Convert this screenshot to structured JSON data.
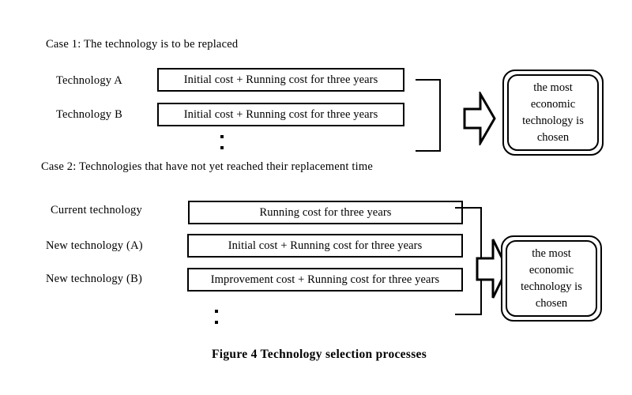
{
  "figure": {
    "caption": "Figure 4   Technology selection processes"
  },
  "case1": {
    "heading": "Case 1: The technology is to be replaced",
    "rows": [
      {
        "label": "Technology A",
        "box": "Initial cost + Running cost for three years"
      },
      {
        "label": "Technology B",
        "box": "Initial cost + Running cost for three years"
      }
    ],
    "ellipsis": "vertical-ellipsis",
    "arrow": "right-block-arrow",
    "result": {
      "lines": [
        "the most",
        "economic",
        "technology is",
        "chosen"
      ]
    }
  },
  "case2": {
    "heading": "Case 2:  Technologies that have not yet reached their replacement time",
    "rows": [
      {
        "label": "Current technology",
        "box": "Running cost for three years"
      },
      {
        "label": "New technology (A)",
        "box": "Initial cost + Running cost for three years"
      },
      {
        "label": "New technology (B)",
        "box": "Improvement cost + Running cost for three years"
      }
    ],
    "ellipsis": "vertical-ellipsis",
    "arrow": "right-block-arrow",
    "result": {
      "lines": [
        "the most",
        "economic",
        "technology is",
        "chosen"
      ]
    }
  },
  "colors": {
    "ink": "#000000",
    "paper": "#ffffff"
  }
}
